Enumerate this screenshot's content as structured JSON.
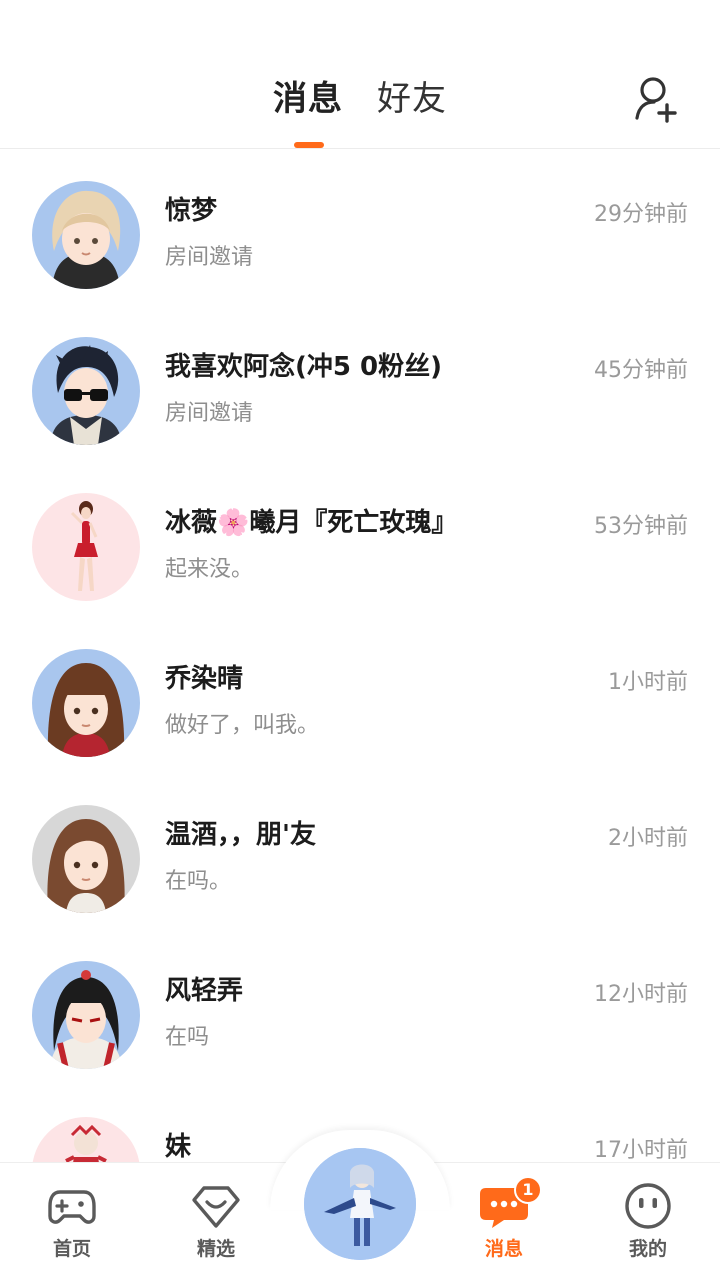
{
  "header": {
    "tabs": [
      {
        "label": "消息",
        "active": true
      },
      {
        "label": "好友",
        "active": false
      }
    ],
    "add_friend_icon": "add-user-icon"
  },
  "conversations": [
    {
      "name": "惊梦",
      "preview": "房间邀请",
      "time": "29分钟前",
      "avatar_bg": "#a9c6ee"
    },
    {
      "name": "我喜欢阿念(冲5   0粉丝)",
      "preview": "房间邀请",
      "time": "45分钟前",
      "avatar_bg": "#a9c6ee"
    },
    {
      "name": "冰薇🌸曦月『死亡玫瑰』",
      "preview": "起来没。",
      "time": "53分钟前",
      "avatar_bg": "#fde4e6"
    },
    {
      "name": "乔染晴",
      "preview": "做好了，叫我。",
      "time": "1小时前",
      "avatar_bg": "#a9c6ee"
    },
    {
      "name": "温酒，，朋'友",
      "preview": "在吗。",
      "time": "2小时前",
      "avatar_bg": "#d7d7d7"
    },
    {
      "name": "风轻弄",
      "preview": "在吗",
      "time": "12小时前",
      "avatar_bg": "#a9c6ee"
    },
    {
      "name": "妹",
      "preview": "",
      "time": "17小时前",
      "avatar_bg": "#fde4e6"
    }
  ],
  "tabbar": {
    "items": [
      {
        "label": "首页",
        "icon": "gamepad-icon"
      },
      {
        "label": "精选",
        "icon": "heart-badge-icon"
      },
      {
        "label": "消息",
        "icon": "chat-bubble-icon",
        "active": true,
        "badge": "1"
      },
      {
        "label": "我的",
        "icon": "face-icon"
      }
    ],
    "center_icon": "character-avatar-icon"
  },
  "colors": {
    "accent": "#ff6a1a",
    "avatar_blue": "#a9c6ee",
    "avatar_pink": "#fde4e6",
    "text_gray": "#8e8e8e"
  }
}
